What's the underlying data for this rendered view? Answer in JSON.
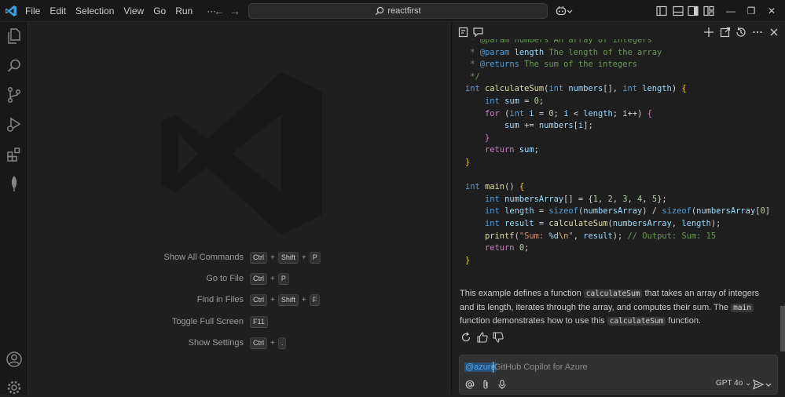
{
  "titlebar": {
    "menu": [
      "File",
      "Edit",
      "Selection",
      "View",
      "Go",
      "Run",
      "···"
    ],
    "search_text": "reactfirst"
  },
  "shortcuts": [
    {
      "label": "Show All Commands",
      "keys": [
        "Ctrl",
        "Shift",
        "P"
      ]
    },
    {
      "label": "Go to File",
      "keys": [
        "Ctrl",
        "P"
      ]
    },
    {
      "label": "Find in Files",
      "keys": [
        "Ctrl",
        "Shift",
        "F"
      ]
    },
    {
      "label": "Toggle Full Screen",
      "keys": [
        "F11"
      ]
    },
    {
      "label": "Show Settings",
      "keys": [
        "Ctrl",
        "."
      ]
    }
  ],
  "chat": {
    "code_lines": [
      [
        [
          "c-com",
          " * @param numbers An array of integers"
        ]
      ],
      [
        [
          "c-com",
          " * "
        ],
        [
          "c-tag",
          "@param"
        ],
        [
          "c-com",
          " "
        ],
        [
          "c-var",
          "length"
        ],
        [
          "c-com",
          " The length of the array"
        ]
      ],
      [
        [
          "c-com",
          " * "
        ],
        [
          "c-tag",
          "@returns"
        ],
        [
          "c-com",
          " The sum of the integers"
        ]
      ],
      [
        [
          "c-com",
          " */"
        ]
      ],
      [
        [
          "c-kw",
          "int "
        ],
        [
          "c-fn",
          "calculateSum"
        ],
        [
          "",
          "("
        ],
        [
          "c-kw",
          "int "
        ],
        [
          "c-var",
          "numbers"
        ],
        [
          "",
          "[], "
        ],
        [
          "c-kw",
          "int "
        ],
        [
          "c-var",
          "length"
        ],
        [
          "",
          ") "
        ],
        [
          "c-br",
          "{"
        ]
      ],
      [
        [
          "",
          "    "
        ],
        [
          "c-kw",
          "int "
        ],
        [
          "c-var",
          "sum"
        ],
        [
          "",
          " = "
        ],
        [
          "c-num",
          "0"
        ],
        [
          "",
          ";"
        ]
      ],
      [
        [
          "",
          "    "
        ],
        [
          "c-ctrl",
          "for"
        ],
        [
          "",
          " ("
        ],
        [
          "c-kw",
          "int "
        ],
        [
          "c-var",
          "i"
        ],
        [
          "",
          " = "
        ],
        [
          "c-num",
          "0"
        ],
        [
          "",
          "; "
        ],
        [
          "c-var",
          "i"
        ],
        [
          "",
          " < "
        ],
        [
          "c-var",
          "length"
        ],
        [
          "",
          "; "
        ],
        [
          "c-var",
          "i"
        ],
        [
          "",
          "++) "
        ],
        [
          "c-ctrl",
          "{"
        ]
      ],
      [
        [
          "",
          "        "
        ],
        [
          "c-var",
          "sum"
        ],
        [
          "",
          " += "
        ],
        [
          "c-var",
          "numbers"
        ],
        [
          "",
          "["
        ],
        [
          "c-var",
          "i"
        ],
        [
          "",
          "];"
        ]
      ],
      [
        [
          "",
          "    "
        ],
        [
          "c-ctrl",
          "}"
        ]
      ],
      [
        [
          "",
          "    "
        ],
        [
          "c-ctrl",
          "return"
        ],
        [
          "",
          " "
        ],
        [
          "c-var",
          "sum"
        ],
        [
          "",
          ";"
        ]
      ],
      [
        [
          "c-br",
          "}"
        ]
      ],
      [
        [
          "",
          ""
        ]
      ],
      [
        [
          "c-kw",
          "int "
        ],
        [
          "c-fn",
          "main"
        ],
        [
          "",
          "() "
        ],
        [
          "c-br",
          "{"
        ]
      ],
      [
        [
          "",
          "    "
        ],
        [
          "c-kw",
          "int "
        ],
        [
          "c-var",
          "numbersArray"
        ],
        [
          "",
          "[] = {"
        ],
        [
          "c-num",
          "1"
        ],
        [
          "",
          ", "
        ],
        [
          "c-num",
          "2"
        ],
        [
          "",
          ", "
        ],
        [
          "c-num",
          "3"
        ],
        [
          "",
          ", "
        ],
        [
          "c-num",
          "4"
        ],
        [
          "",
          ", "
        ],
        [
          "c-num",
          "5"
        ],
        [
          "",
          "};"
        ]
      ],
      [
        [
          "",
          "    "
        ],
        [
          "c-kw",
          "int "
        ],
        [
          "c-var",
          "length"
        ],
        [
          "",
          " = "
        ],
        [
          "c-kw",
          "sizeof"
        ],
        [
          "",
          "("
        ],
        [
          "c-var",
          "numbersArray"
        ],
        [
          "",
          ") / "
        ],
        [
          "c-kw",
          "sizeof"
        ],
        [
          "",
          "("
        ],
        [
          "c-var",
          "numbersArray"
        ],
        [
          "",
          "["
        ],
        [
          "c-num",
          "0"
        ],
        [
          "",
          "]);"
        ]
      ],
      [
        [
          "",
          "    "
        ],
        [
          "c-kw",
          "int "
        ],
        [
          "c-var",
          "result"
        ],
        [
          "",
          " = "
        ],
        [
          "c-fn",
          "calculateSum"
        ],
        [
          "",
          "("
        ],
        [
          "c-var",
          "numbersArray"
        ],
        [
          "",
          ", "
        ],
        [
          "c-var",
          "length"
        ],
        [
          "",
          ");"
        ]
      ],
      [
        [
          "",
          "    "
        ],
        [
          "c-fn",
          "printf"
        ],
        [
          "",
          "("
        ],
        [
          "c-str",
          "\"Sum: "
        ],
        [
          "c-var",
          "%d"
        ],
        [
          "c-esc",
          "\\n"
        ],
        [
          "c-str",
          "\""
        ],
        [
          "",
          ", "
        ],
        [
          "c-var",
          "result"
        ],
        [
          "",
          "); "
        ],
        [
          "c-com",
          "// Output: Sum: 15"
        ]
      ],
      [
        [
          "",
          "    "
        ],
        [
          "c-ctrl",
          "return"
        ],
        [
          "",
          " "
        ],
        [
          "c-num",
          "0"
        ],
        [
          "",
          ";"
        ]
      ],
      [
        [
          "c-br",
          "}"
        ]
      ]
    ],
    "explanation": [
      {
        "t": "This example defines a function "
      },
      {
        "c": "calculateSum"
      },
      {
        "t": " that takes an array of integers and its length, iterates through the array, and computes their sum. The "
      },
      {
        "c": "main"
      },
      {
        "t": " function demonstrates how to use this "
      },
      {
        "c": "calculateSum"
      },
      {
        "t": " function."
      }
    ],
    "input": {
      "mention": "@azure",
      "placeholder": "GitHub Copilot for Azure",
      "model": "GPT 4o"
    }
  },
  "colors": {
    "accent": "#007acc",
    "background": "#1f1f1f",
    "titlebar": "#181818",
    "mention": "#4daafc"
  }
}
